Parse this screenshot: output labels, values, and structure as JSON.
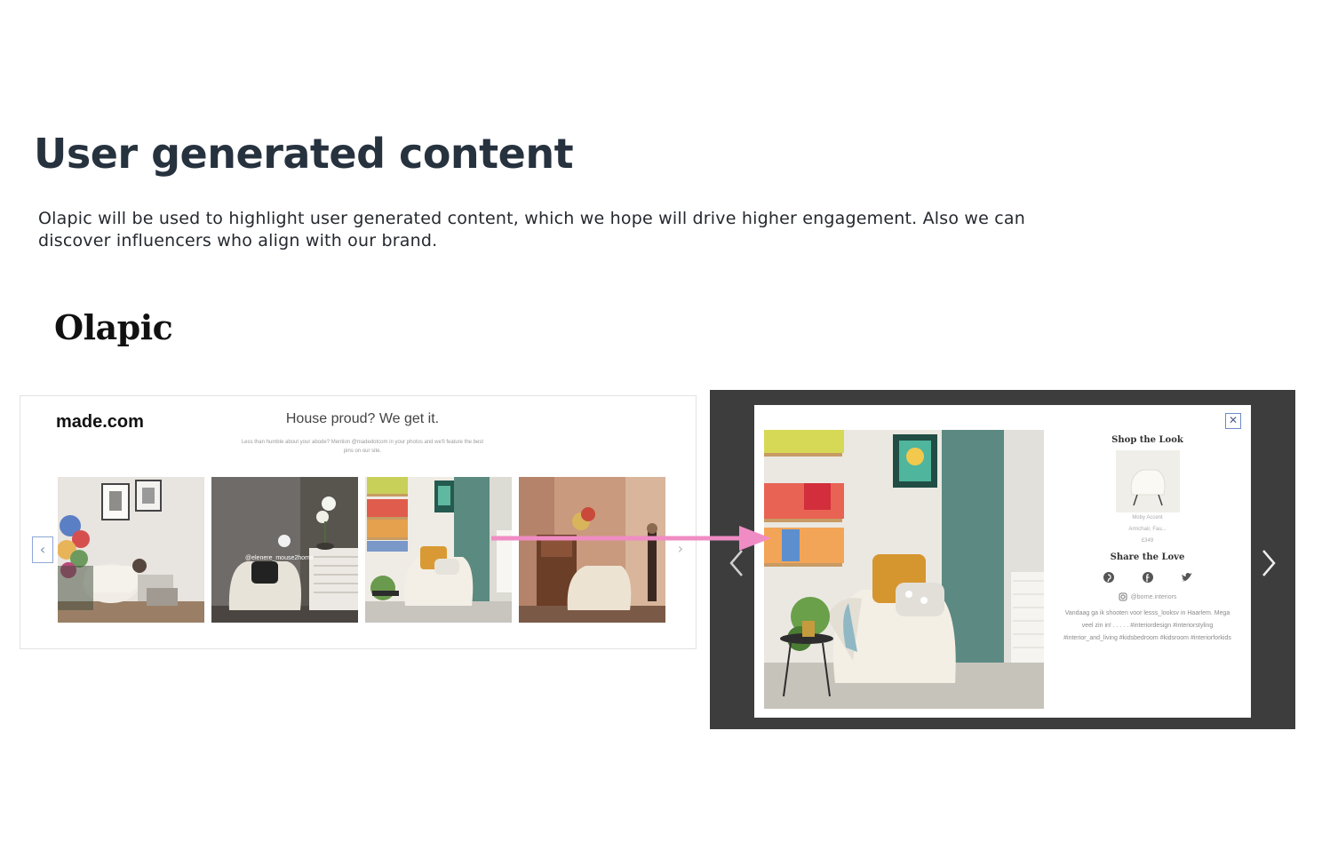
{
  "page": {
    "title": "User generated content",
    "intro": "Olapic will be used to highlight user generated content, which we hope will drive higher engagement. Also we can discover influencers who align with our brand.",
    "logo_text": "Olapic"
  },
  "widget": {
    "brand": "made.com",
    "heading": "House proud? We get it.",
    "subtext": "Less than humble about your abode? Mention @madedotcom in your photos and we'll feature the best pins on our site.",
    "prev_icon": "chevron-left-icon",
    "next_icon": "chevron-right-icon",
    "photos": [
      {
        "name": "photo-living-room-flowers"
      },
      {
        "name": "photo-grey-room-chair",
        "overlay_text": "@elenere_mouse2home"
      },
      {
        "name": "photo-kids-room-chair"
      },
      {
        "name": "photo-pink-room-chair"
      }
    ]
  },
  "lightbox": {
    "close_icon": "close-icon",
    "shop_heading": "Shop the Look",
    "product_name": "Moby Accent",
    "product_desc": "Armchair, Fau...",
    "product_price": "£349",
    "share_heading": "Share the Love",
    "share_icons": [
      "pinterest-icon",
      "facebook-icon",
      "twitter-icon"
    ],
    "instagram_handle": "@borne.interiors",
    "caption": "Vandaag ga ik shooten voor lesss_looksv in Haarlem. Mega veel zin in! . . . . . #interiordesign #interiorstyling #interior_and_living #kidsbedroom #kidsroom #interiorforkids"
  },
  "colors": {
    "title": "#27323f",
    "arrow": "#f08cc4",
    "lightbox_bg": "#3d3d3d",
    "nav_border": "#8ea6d6"
  }
}
